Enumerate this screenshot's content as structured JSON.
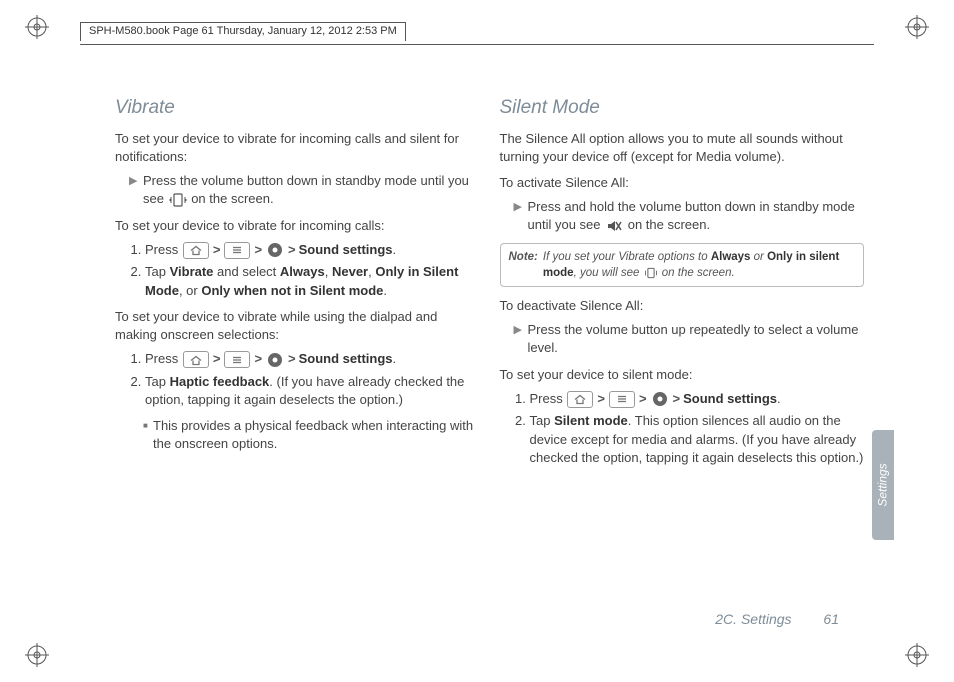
{
  "header_text": "SPH-M580.book  Page 61  Thursday, January 12, 2012  2:53 PM",
  "side_tab": "Settings",
  "footer_section": "2C. Settings",
  "footer_page": "61",
  "left": {
    "heading": "Vibrate",
    "p1": "To set your device to vibrate for incoming calls and silent for notifications:",
    "b1a": "Press the volume button down in standby mode until you see ",
    "b1b": " on the screen.",
    "p2": "To set your device to vibrate for incoming calls:",
    "ol1_1a": "Press ",
    "sound_settings": "Sound settings",
    "ol1_2a": "Tap ",
    "vibrate": "Vibrate",
    "ol1_2b": " and select ",
    "always": "Always",
    "never": "Never",
    "only_silent": "Only in Silent Mode",
    "or": ", or ",
    "only_not_silent": "Only when not in Silent mode",
    "p3": "To set your device to vibrate while using the dialpad and making onscreen selections:",
    "ol2_2a": "Tap ",
    "haptic": "Haptic feedback",
    "ol2_2b": ". (If you have already checked the option, tapping it again deselects the option.)",
    "sub": "This provides a physical feedback when interacting with the onscreen options."
  },
  "right": {
    "heading": "Silent Mode",
    "p1": "The Silence All option allows you to mute all sounds without turning your device off (except for Media volume).",
    "p2": "To activate Silence All:",
    "b1a": "Press and hold the volume button down in standby mode until you see ",
    "b1b": " on the screen.",
    "note_label": "Note:",
    "note_a": "If you set your Vibrate options to ",
    "note_always": "Always",
    "note_or": " or ",
    "note_only": "Only in silent mode",
    "note_b": ", you will see ",
    "note_c": " on the screen.",
    "p3": "To deactivate Silence All:",
    "b2": "Press the volume button up repeatedly to select a volume level.",
    "p4": "To set your device to silent mode:",
    "ol_1a": "Press ",
    "sound_settings": "Sound settings",
    "ol_2a": "Tap ",
    "silent_mode": "Silent mode",
    "ol_2b": ". This option silences all audio on the device except for media and alarms. (If you have already checked the option, tapping it again deselects this option.)"
  }
}
